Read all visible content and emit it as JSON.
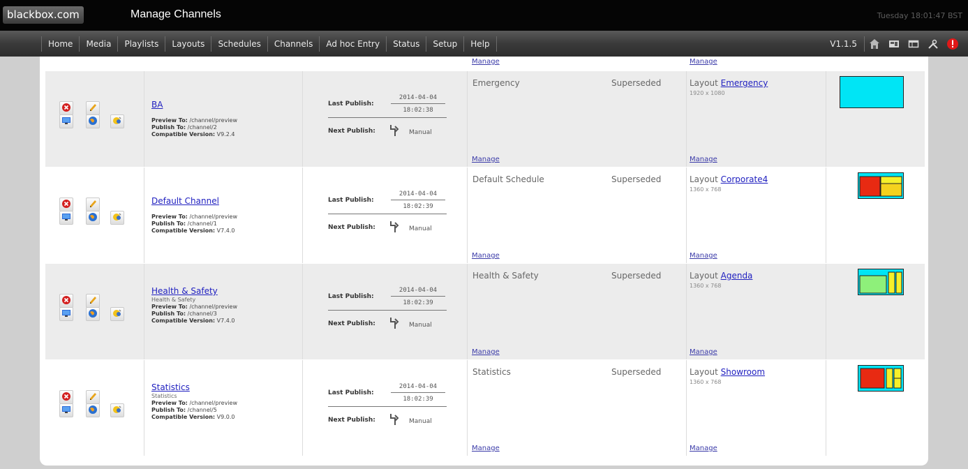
{
  "header": {
    "logo": "blackbox.com",
    "title": "Manage Channels",
    "datetime": "Tuesday 18:01:47 BST"
  },
  "nav": {
    "items": [
      "Home",
      "Media",
      "Playlists",
      "Layouts",
      "Schedules",
      "Channels",
      "Ad hoc Entry",
      "Status",
      "Setup",
      "Help"
    ],
    "version": "V1.1.5",
    "tools": [
      "home-icon",
      "layout-grid-icon",
      "window-icon",
      "tools-icon",
      "alert-icon"
    ]
  },
  "labels": {
    "manage": "Manage",
    "last_publish": "Last Publish:",
    "next_publish": "Next Publish:",
    "manual": "Manual",
    "preview_to": "Preview To:",
    "publish_to": "Publish To:",
    "compatible_version": "Compatible Version:",
    "layout_prefix": "Layout"
  },
  "channels": [
    {
      "name": "BA",
      "subtitle": "",
      "preview_to": "/channel/preview",
      "publish_to": "/channel/2",
      "compatible_version": "V9.2.4",
      "last_publish_date": "2014-04-04",
      "last_publish_time": "18:02:38",
      "schedule": "Emergency",
      "status": "Superseded",
      "layout_name": "Emergency",
      "layout_resolution": "1920 x 1080",
      "thumb_colors": [
        "#00e5f5"
      ]
    },
    {
      "name": "Default Channel",
      "subtitle": "",
      "preview_to": "/channel/preview",
      "publish_to": "/channel/1",
      "compatible_version": "V7.4.0",
      "last_publish_date": "2014-04-04",
      "last_publish_time": "18:02:39",
      "schedule": "Default Schedule",
      "status": "Superseded",
      "layout_name": "Corporate4",
      "layout_resolution": "1360 x 768",
      "thumb_colors": [
        "#00e5f5",
        "#e82a12",
        "#f5f02a",
        "#f5d21e"
      ]
    },
    {
      "name": "Health & Safety",
      "subtitle": "Health & Safety",
      "preview_to": "/channel/preview",
      "publish_to": "/channel/3",
      "compatible_version": "V7.4.0",
      "last_publish_date": "2014-04-04",
      "last_publish_time": "18:02:39",
      "schedule": "Health & Safety",
      "status": "Superseded",
      "layout_name": "Agenda",
      "layout_resolution": "1360 x 768",
      "thumb_colors": [
        "#00e5f5",
        "#8ef07a",
        "#f5f02a"
      ]
    },
    {
      "name": "Statistics",
      "subtitle": "Statistics",
      "preview_to": "/channel/preview",
      "publish_to": "/channel/5",
      "compatible_version": "V9.0.0",
      "last_publish_date": "2014-04-04",
      "last_publish_time": "18:02:39",
      "schedule": "Statistics",
      "status": "Superseded",
      "layout_name": "Showroom",
      "layout_resolution": "1360 x 768",
      "thumb_colors": [
        "#00e5f5",
        "#e82a12",
        "#f5f02a"
      ]
    }
  ]
}
